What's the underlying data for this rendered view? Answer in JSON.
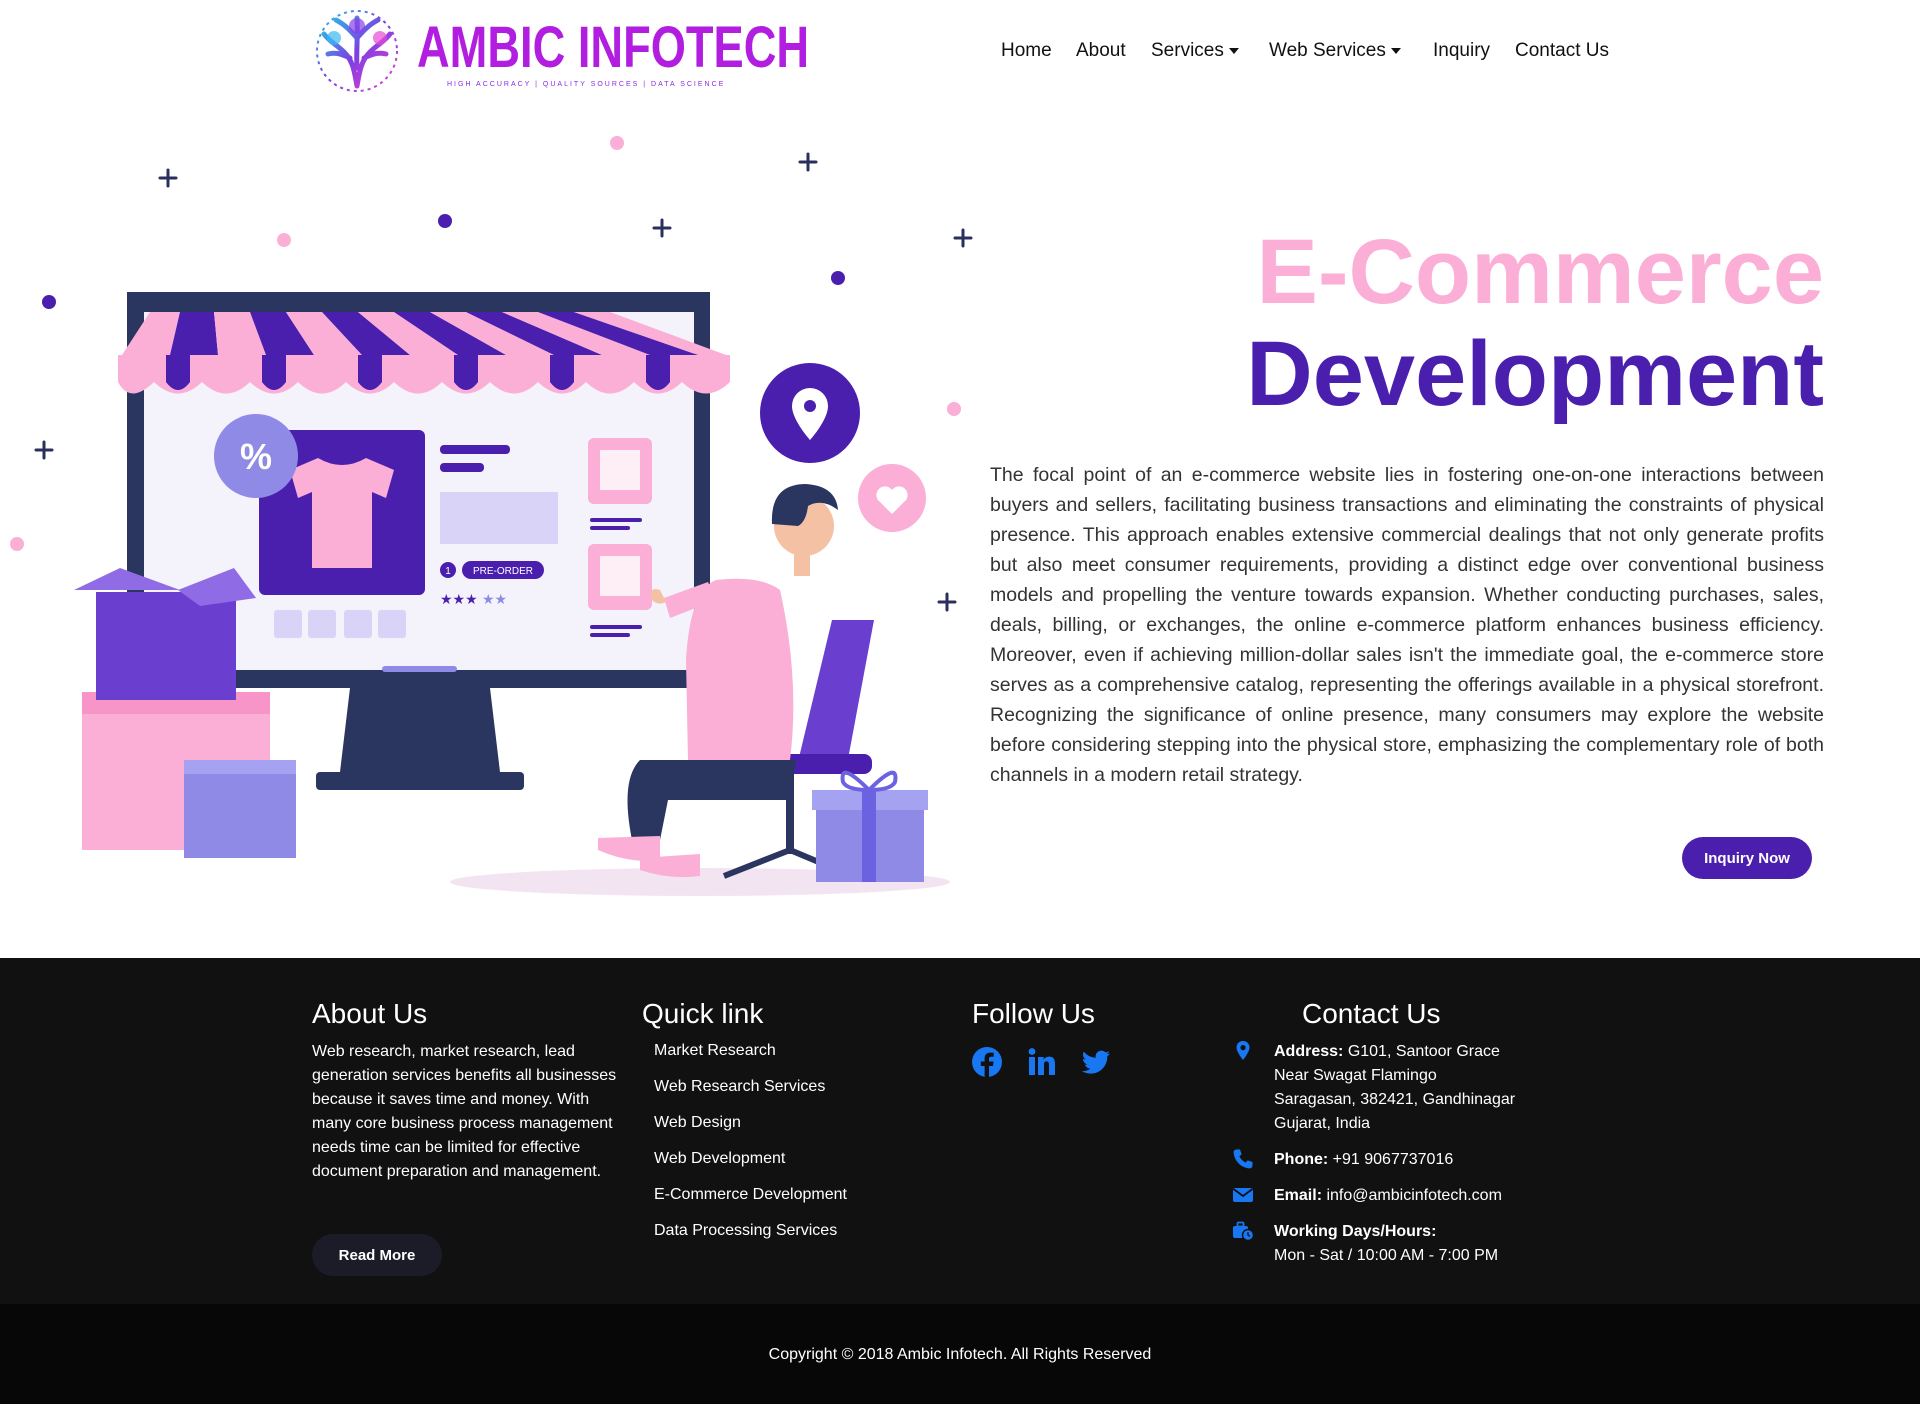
{
  "brand": {
    "name": "AMBIC INFOTECH",
    "tagline": "HIGH ACCURACY | QUALITY SOURCES | DATA SCIENCE"
  },
  "nav": {
    "home": "Home",
    "about": "About",
    "services": "Services",
    "web_services": "Web Services",
    "inquiry": "Inquiry",
    "contact": "Contact Us"
  },
  "hero": {
    "title_line1": "E-Commerce",
    "title_line2": "Development",
    "description": "The focal point of an e-commerce website lies in fostering one-on-one interactions between buyers and sellers, facilitating business transactions and eliminating the constraints of physical presence. This approach enables extensive commercial dealings that not only generate profits but also meet consumer requirements, providing a distinct edge over conventional business models and propelling the venture towards expansion. Whether conducting purchases, sales, deals, billing, or exchanges, the online e-commerce platform enhances business efficiency. Moreover, even if achieving million-dollar sales isn't the immediate goal, the e-commerce store serves as a comprehensive catalog, representing the offerings available in a physical storefront. Recognizing the significance of online presence, many consumers may explore the website before considering stepping into the physical store, emphasizing the complementary role of both channels in a modern retail strategy.",
    "cta_label": "Inquiry Now",
    "illustration": {
      "discount_badge": "%",
      "preorder_label": "PRE-ORDER",
      "preorder_count": "1"
    }
  },
  "footer": {
    "about": {
      "heading": "About Us",
      "text": "Web research, market research, lead generation services benefits all businesses because it saves time and money. With many core business process management needs time can be limited for effective document preparation and management.",
      "button": "Read More"
    },
    "quick_links": {
      "heading": "Quick link",
      "items": [
        "Market Research",
        "Web Research Services",
        "Web Design",
        "Web Development",
        "E-Commerce Development",
        "Data Processing Services"
      ]
    },
    "follow": {
      "heading": "Follow Us",
      "icons": [
        "facebook-icon",
        "linkedin-icon",
        "twitter-icon"
      ]
    },
    "contact": {
      "heading": "Contact Us",
      "address_label": "Address:",
      "address_lines": [
        "G101, Santoor Grace",
        "Near Swagat Flamingo",
        "Saragasan, 382421, Gandhinagar",
        "Gujarat, India"
      ],
      "phone_label": "Phone:",
      "phone": "+91 9067737016",
      "email_label": "Email:",
      "email": "info@ambicinfotech.com",
      "hours_label": "Working Days/Hours:",
      "hours": "Mon - Sat / 10:00 AM - 7:00 PM"
    },
    "copyright": "Copyright © 2018 Ambic Infotech. All Rights Reserved"
  },
  "colors": {
    "primary_purple": "#4b1fae",
    "accent_pink": "#fbaed6",
    "brand_magenta": "#b21ee0",
    "footer_bg": "#111112",
    "icon_blue": "#1877f2"
  }
}
